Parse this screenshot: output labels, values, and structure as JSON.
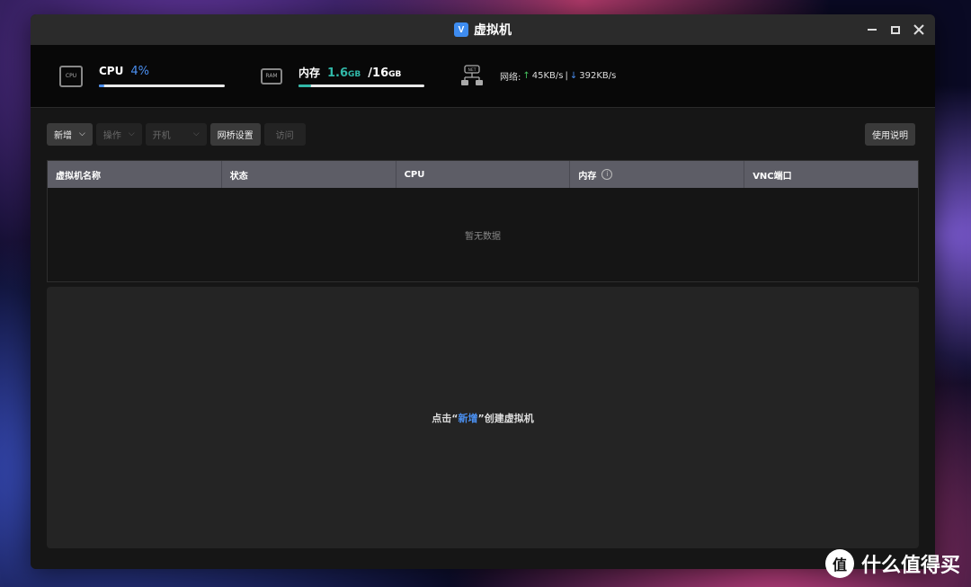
{
  "window": {
    "title": "虚拟机",
    "app_icon": "V",
    "controls": [
      "minimize-icon",
      "maximize-icon",
      "close-icon"
    ]
  },
  "stats": {
    "cpu": {
      "label": "CPU",
      "value": "4%",
      "percent": 4
    },
    "memory": {
      "label": "内存",
      "used": "1.6",
      "used_unit": "GB",
      "separator": "/",
      "total": "16",
      "total_unit": "GB",
      "percent": 10
    },
    "network": {
      "label": "网络:",
      "up_arrow": "↑",
      "up": "45KB/s",
      "divider": "|",
      "down_arrow": "↓",
      "down": "392KB/s"
    },
    "icons": {
      "cpu": "CPU",
      "ram": "RAM",
      "net": "NET"
    }
  },
  "toolbar": {
    "new_label": "新增",
    "operate_label": "操作",
    "power_label": "开机",
    "bridge_label": "网桥设置",
    "visit_label": "访问",
    "help_label": "使用说明",
    "caret": "⌵"
  },
  "table": {
    "columns": [
      "虚拟机名称",
      "状态",
      "CPU",
      "内存",
      "VNC端口"
    ],
    "info_icon": "i",
    "empty_text": "暂无数据"
  },
  "panel": {
    "hint_prefix": "点击“",
    "hint_link": "新增",
    "hint_suffix": "”创建虚拟机"
  },
  "watermark": {
    "badge": "值",
    "text": "什么值得买"
  },
  "colors": {
    "accent": "#4a8ff0",
    "memory": "#31b8a8",
    "up": "#45c35f"
  }
}
